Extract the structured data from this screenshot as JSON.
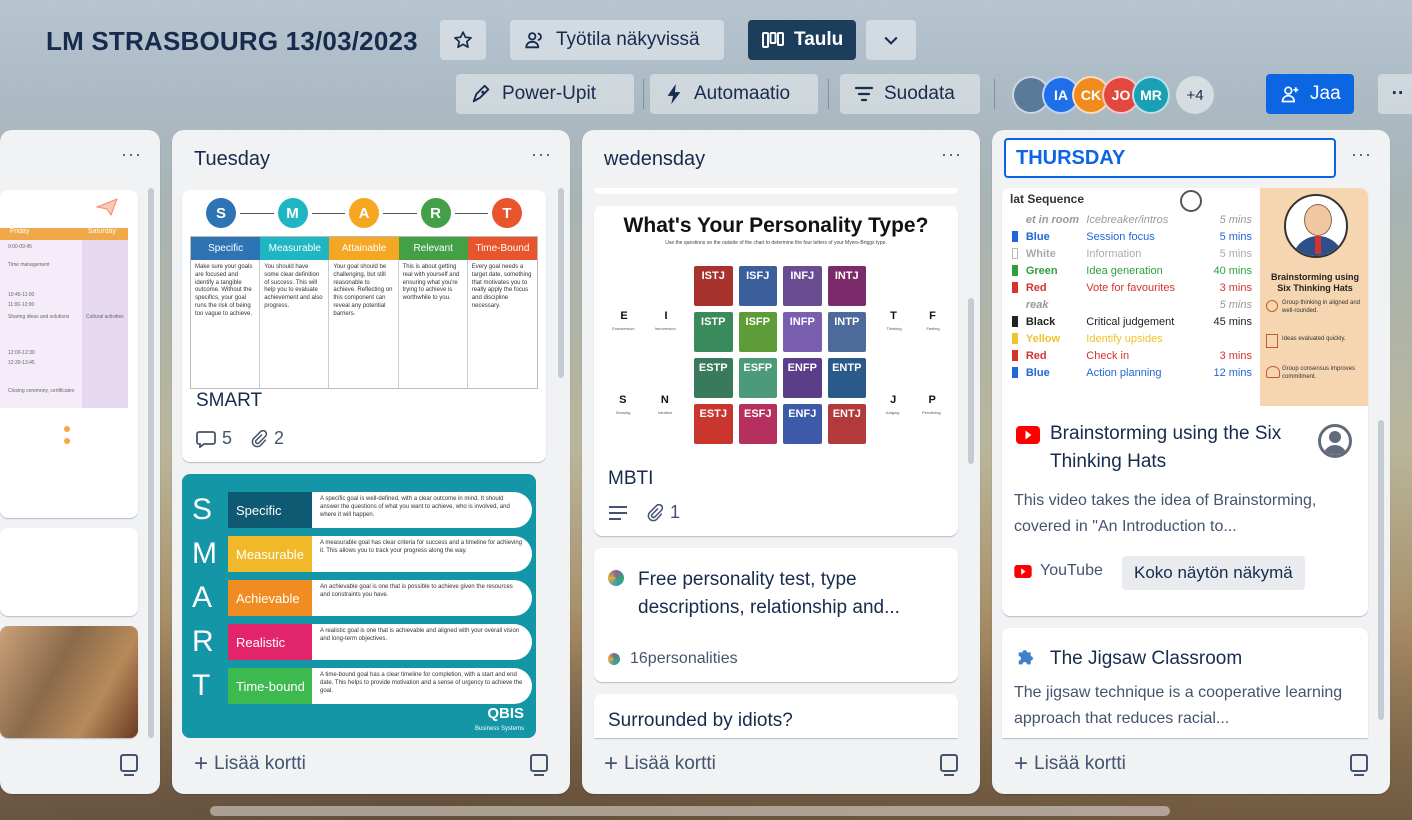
{
  "board": {
    "title": "LM STRASBOURG 13/03/2023",
    "visibility_label": "Työtila näkyvissä",
    "view_label": "Taulu",
    "powerups_label": "Power-Upit",
    "automation_label": "Automaatio",
    "filter_label": "Suodata",
    "share_label": "Jaa",
    "members": [
      {
        "initials": "",
        "color": "#5a7a9a"
      },
      {
        "initials": "IA",
        "color": "#1f6feb"
      },
      {
        "initials": "CK",
        "color": "#f08c1e"
      },
      {
        "initials": "JO",
        "color": "#e2483d"
      },
      {
        "initials": "MR",
        "color": "#1aa0b5"
      }
    ],
    "members_more": "+4"
  },
  "lists": {
    "add_card_label": "Lisää kortti",
    "menu_label": "···",
    "monday": {
      "schedule_headers": [
        "Friday",
        "Saturday"
      ],
      "schedule_items": [
        "9:00-09:45",
        "Time management",
        "10:45-11:00",
        "11:00-12:00",
        "Sharing ideas and solutions",
        "12:00-12:30",
        "12:30-13:45",
        "Closing ceremony, certificates",
        "Cultural activities"
      ]
    },
    "tuesday": {
      "title": "Tuesday",
      "smart_card": {
        "title": "SMART",
        "comments": "5",
        "attachments": "2",
        "letters": [
          "S",
          "M",
          "A",
          "R",
          "T"
        ],
        "headers": [
          "Specific",
          "Measurable",
          "Attainable",
          "Relevant",
          "Time-Bound"
        ],
        "colors": [
          "#2e74b5",
          "#1fb6c3",
          "#f5a623",
          "#43a047",
          "#e8552d"
        ],
        "descriptions": [
          "Make sure your goals are focused and identify a tangible outcome. Without the specifics, your goal runs the risk of being too vague to achieve.",
          "You should have some clear definition of success. This will help you to evaluate achievement and also progress.",
          "Your goal should be challenging, but still reasonable to achieve. Reflecting on this component can reveal any potential barriers.",
          "This is about getting real with yourself and ensuring what you're trying to achieve is worthwhile to you.",
          "Every goal needs a target date, something that motivates you to really apply the focus and discipline necessary."
        ]
      },
      "poster": {
        "letters": [
          "S",
          "M",
          "A",
          "R",
          "T"
        ],
        "words": [
          "Specific",
          "Measurable",
          "Achievable",
          "Realistic",
          "Time-bound"
        ],
        "colors": [
          "#0e5a73",
          "#f0b92a",
          "#f08c22",
          "#e2256b",
          "#3dba4f"
        ],
        "descriptions": [
          "A specific goal is well-defined, with a clear outcome in mind. It should answer the questions of what you want to achieve, who is involved, and where it will happen.",
          "A measurable goal has clear criteria for success and a timeline for achieving it. This allows you to track your progress along the way.",
          "An achievable goal is one that is possible to achieve given the resources and constraints you have.",
          "A realistic goal is one that is achievable and aligned with your overall vision and long-term objectives.",
          "A time-bound goal has a clear timeline for completion, with a start and end date. This helps to provide motivation and a sense of urgency to achieve the goal."
        ],
        "brand": "QBIS",
        "brand_sub": "Business Systems"
      }
    },
    "wednesday": {
      "title": "wedensday",
      "mbti_card": {
        "image_title": "What's Your Personality Type?",
        "image_subtitle": "Use the questions on the outside of the chart to determine the four letters of your Myers-Briggs type.",
        "types": [
          "ISTJ",
          "ISFJ",
          "INFJ",
          "INTJ",
          "ISTP",
          "ISFP",
          "INFP",
          "INTP",
          "ESTP",
          "ESFP",
          "ENFP",
          "ENTP",
          "ESTJ",
          "ESFJ",
          "ENFJ",
          "ENTJ"
        ],
        "type_colors": [
          "#a8322d",
          "#3a5f9a",
          "#6a4c93",
          "#7b2b6a",
          "#3a8a5c",
          "#5e9c3a",
          "#7a5fb0",
          "#4c6a9a",
          "#3a7a5c",
          "#4b9a7a",
          "#5b3d8a",
          "#2a5a8a",
          "#c9362e",
          "#b52f5f",
          "#3d5aa8",
          "#b33a3a"
        ],
        "left_letters": [
          "E",
          "I",
          "S",
          "N"
        ],
        "left_words": [
          "Extraversion",
          "Introversion",
          "Sensing",
          "Intuition"
        ],
        "right_letters": [
          "T",
          "F",
          "J",
          "P"
        ],
        "right_words": [
          "Thinking",
          "Feeling",
          "Judging",
          "Perceiving"
        ],
        "title": "MBTI",
        "attachments": "1"
      },
      "link_card": {
        "title": "Free personality test, type descriptions, relationship and...",
        "source": "16personalities"
      },
      "partial_card_title": "Surrounded by idiots?"
    },
    "thursday": {
      "title_input": "THURSDAY",
      "poster": {
        "heading": "lat Sequence",
        "rows": [
          {
            "color": "",
            "label": "et in room",
            "desc": "Icebreaker/intros",
            "time": "5 mins"
          },
          {
            "color": "#1f66d6",
            "label": "Blue",
            "desc": "Session focus",
            "time": "5 mins"
          },
          {
            "color": "#ffffff",
            "label": "White",
            "desc": "Information",
            "time": "5 mins"
          },
          {
            "color": "#2e9e3e",
            "label": "Green",
            "desc": "Idea generation",
            "time": "40 mins"
          },
          {
            "color": "#d6322e",
            "label": "Red",
            "desc": "Vote for favourites",
            "time": "3 mins"
          },
          {
            "color": "",
            "label": "reak",
            "desc": "",
            "time": "5 mins"
          },
          {
            "color": "#222222",
            "label": "Black",
            "desc": "Critical judgement",
            "time": "45 mins"
          },
          {
            "color": "#f2c12e",
            "label": "Yellow",
            "desc": "Identify upsides",
            "time": ""
          },
          {
            "color": "#d6322e",
            "label": "Red",
            "desc": "Check in",
            "time": "3 mins"
          },
          {
            "color": "#1f66d6",
            "label": "Blue",
            "desc": "Action planning",
            "time": "12 mins"
          }
        ],
        "side_title": "Brainstorming using Six Thinking Hats",
        "side_points": [
          "Group thinking in aligned and well-rounded.",
          "Ideas evaluated quickly.",
          "Group consensus improves commitment."
        ]
      },
      "video_card": {
        "title": "Brainstorming using the Six Thinking Hats",
        "description": "This video takes the idea of Brainstorming, covered in \"An Introduction to...",
        "source": "YouTube",
        "fullscreen_label": "Koko näytön näkymä"
      },
      "jigsaw_card": {
        "title": "The Jigsaw Classroom",
        "description": "The jigsaw technique is a cooperative learning approach that reduces racial..."
      }
    }
  }
}
